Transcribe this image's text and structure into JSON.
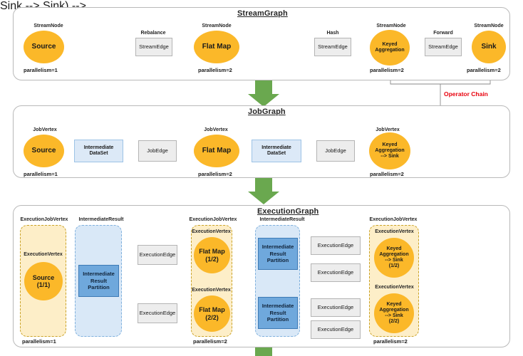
{
  "sections": {
    "streamgraph": {
      "title": "StreamGraph"
    },
    "jobgraph": {
      "title": "JobGraph"
    },
    "executiongraph": {
      "title": "ExecutionGraph"
    }
  },
  "annotations": {
    "operator_chain": "Operator Chain",
    "operator_chain_color": "#e8000d"
  },
  "colors": {
    "node_orange": "#fbb829",
    "edge_grey": "#ededed",
    "dataset_blue": "#dce9f7",
    "partition_blue": "#6fa8dc",
    "group_orange": "#fdeec8",
    "group_blue": "#d9e8f7",
    "arrow_green": "#6aa84f"
  },
  "streamgraph": {
    "nodes": [
      {
        "caption": "StreamNode",
        "label": "Source",
        "parallelism": "parallelism=1"
      },
      {
        "caption": "StreamNode",
        "label": "Flat Map",
        "parallelism": "parallelism=2"
      },
      {
        "caption": "StreamNode",
        "label": "Keyed\nAggregation",
        "label_l1": "Keyed",
        "label_l2": "Aggregation",
        "parallelism": "parallelism=2"
      },
      {
        "caption": "StreamNode",
        "label": "Sink",
        "parallelism": "parallelism=2"
      }
    ],
    "edges": [
      {
        "caption": "Rebalance",
        "label": "StreamEdge"
      },
      {
        "caption": "Hash",
        "label": "StreamEdge"
      },
      {
        "caption": "Forward",
        "label": "StreamEdge"
      }
    ]
  },
  "jobgraph": {
    "nodes": [
      {
        "caption": "JobVertex",
        "label": "Source",
        "parallelism": "parallelism=1"
      },
      {
        "caption": "JobVertex",
        "label": "Flat Map",
        "parallelism": "parallelism=2"
      },
      {
        "caption": "JobVertex",
        "label_l1": "Keyed",
        "label_l2": "Aggregation",
        "label_l3": "--> Sink",
        "parallelism": "parallelism=2"
      }
    ],
    "datasets": [
      {
        "label_l1": "Intermediate",
        "label_l2": "DataSet"
      },
      {
        "label_l1": "Intermediate",
        "label_l2": "DataSet"
      }
    ],
    "edges": [
      {
        "label": "JobEdge"
      },
      {
        "label": "JobEdge"
      }
    ]
  },
  "executiongraph": {
    "groups": [
      {
        "caption": "ExecutionJobVertex",
        "parallelism": "parallelism=1"
      },
      {
        "caption": "IntermediateResult"
      },
      {
        "caption": "ExecutionJobVertex",
        "parallelism": "parallelism=2"
      },
      {
        "caption": "IntermediateResult"
      },
      {
        "caption": "ExecutionJobVertex",
        "parallelism": "parallelism=2"
      }
    ],
    "vertex_caption": "ExecutionVertex",
    "vertices": [
      {
        "caption": "ExecutionVertex",
        "label_l1": "Source",
        "label_l2": "(1/1)"
      },
      {
        "caption": "ExecutionVertex",
        "label_l1": "Flat Map",
        "label_l2": "(1/2)"
      },
      {
        "caption": "ExecutionVertex",
        "label_l1": "Flat Map",
        "label_l2": "(2/2)"
      },
      {
        "caption": "ExecutionVertex",
        "label_l1": "Keyed",
        "label_l2": "Aggregation",
        "label_l3": "--> Sink",
        "label_l4": "(1/2)"
      },
      {
        "caption": "ExecutionVertex",
        "label_l1": "Keyed",
        "label_l2": "Aggregation",
        "label_l3": "--> Sink",
        "label_l4": "(2/2)"
      }
    ],
    "partitions": [
      {
        "label_l1": "Intermediate",
        "label_l2": "Result",
        "label_l3": "Partition"
      },
      {
        "label_l1": "Intermediate",
        "label_l2": "Result",
        "label_l3": "Partition"
      },
      {
        "label_l1": "Intermediate",
        "label_l2": "Result",
        "label_l3": "Partition"
      }
    ],
    "edges": [
      {
        "label": "ExecutionEdge"
      },
      {
        "label": "ExecutionEdge"
      },
      {
        "label": "ExecutionEdge"
      },
      {
        "label": "ExecutionEdge"
      },
      {
        "label": "ExecutionEdge"
      },
      {
        "label": "ExecutionEdge"
      }
    ]
  }
}
